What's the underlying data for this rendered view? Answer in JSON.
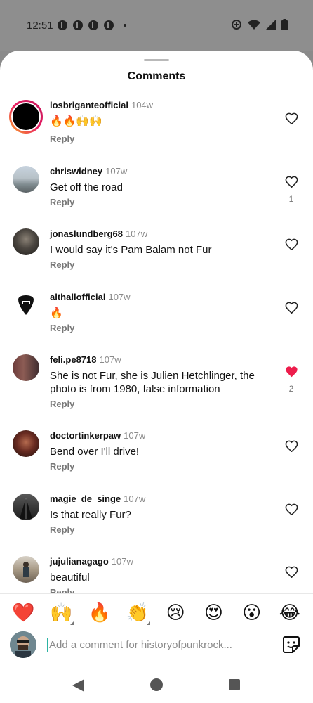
{
  "status_bar": {
    "time": "12:51",
    "notification_icons": [
      "facebook-icon",
      "facebook-icon",
      "facebook-icon",
      "facebook-icon"
    ],
    "right_icons": [
      "data-saver-icon",
      "wifi-icon",
      "signal-icon",
      "battery-icon"
    ]
  },
  "sheet": {
    "title": "Comments"
  },
  "comments": [
    {
      "username": "losbriganteofficial",
      "time": "104w",
      "text": "🔥🔥🙌🙌",
      "reply": "Reply",
      "liked": false,
      "likes": ""
    },
    {
      "username": "chriswidney",
      "time": "107w",
      "text": "Get off the road",
      "reply": "Reply",
      "liked": false,
      "likes": "1"
    },
    {
      "username": "jonaslundberg68",
      "time": "107w",
      "text": "I would say it's Pam Balam not Fur",
      "reply": "Reply",
      "liked": false,
      "likes": ""
    },
    {
      "username": "althallofficial",
      "time": "107w",
      "text": "🔥",
      "reply": "Reply",
      "liked": false,
      "likes": ""
    },
    {
      "username": "feli.pe8718",
      "time": "107w",
      "text": "She is not Fur, she is Julien Hetchlinger, the photo is from 1980, false information",
      "reply": "Reply",
      "liked": true,
      "likes": "2"
    },
    {
      "username": "doctortinkerpaw",
      "time": "107w",
      "text": "Bend over I'll drive!",
      "reply": "Reply",
      "liked": false,
      "likes": ""
    },
    {
      "username": "magie_de_singe",
      "time": "107w",
      "text": "Is that really Fur?",
      "reply": "Reply",
      "liked": false,
      "likes": ""
    },
    {
      "username": "jujulianagago",
      "time": "107w",
      "text": "beautiful",
      "reply": "Reply",
      "liked": false,
      "likes": ""
    }
  ],
  "emoji_bar": [
    "❤️",
    "🙌",
    "🔥",
    "👏",
    "😢",
    "😍",
    "😮",
    "😂"
  ],
  "composer": {
    "placeholder": "Add a comment for historyofpunkrock..."
  },
  "colors": {
    "like_red": "#ed1d4c",
    "cursor": "#2bb3a3",
    "scrim": "#8e8e8e"
  }
}
